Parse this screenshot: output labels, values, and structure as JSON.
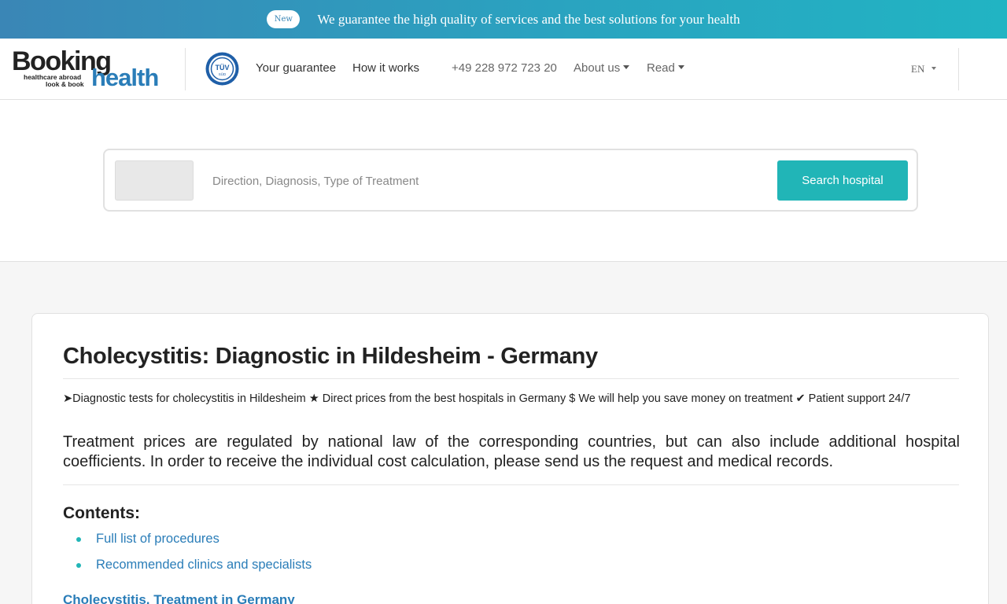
{
  "banner": {
    "badge": "New",
    "text": "We guarantee the high quality of services and the best solutions for your health"
  },
  "header": {
    "logo": {
      "brand_top": "Booking",
      "brand_bottom": "health",
      "tagline_1": "healthcare abroad",
      "tagline_2": "look & book"
    },
    "tuv_badge": {
      "line1": "TÜV",
      "line2": "SÜD"
    },
    "nav": {
      "guarantee": "Your guarantee",
      "how": "How it works",
      "phone": "+49 228 972 723 20",
      "about": "About us",
      "read": "Read"
    },
    "language": "EN"
  },
  "search": {
    "placeholder": "Direction, Diagnosis, Type of Treatment",
    "button": "Search hospital"
  },
  "content": {
    "title": "Cholecystitis: Diagnostic in Hildesheim - Germany",
    "subtitle": "➤Diagnostic tests for cholecystitis in Hildesheim ★ Direct prices from the best hospitals in Germany $ We will help you save money on treatment ✔ Patient support 24/7",
    "notice": "Treatment prices are regulated by national law of the corresponding countries, but can also include additional hospital coefficients. In order to receive the individual cost calculation, please send us the request and medical records.",
    "contents_heading": "Contents:",
    "contents_items": [
      "Full list of procedures",
      "Recommended clinics and specialists"
    ],
    "bottom_link": "Cholecystitis. Treatment in Germany"
  },
  "colors": {
    "accent_teal": "#21b5b7",
    "brand_blue": "#2a7db8"
  }
}
